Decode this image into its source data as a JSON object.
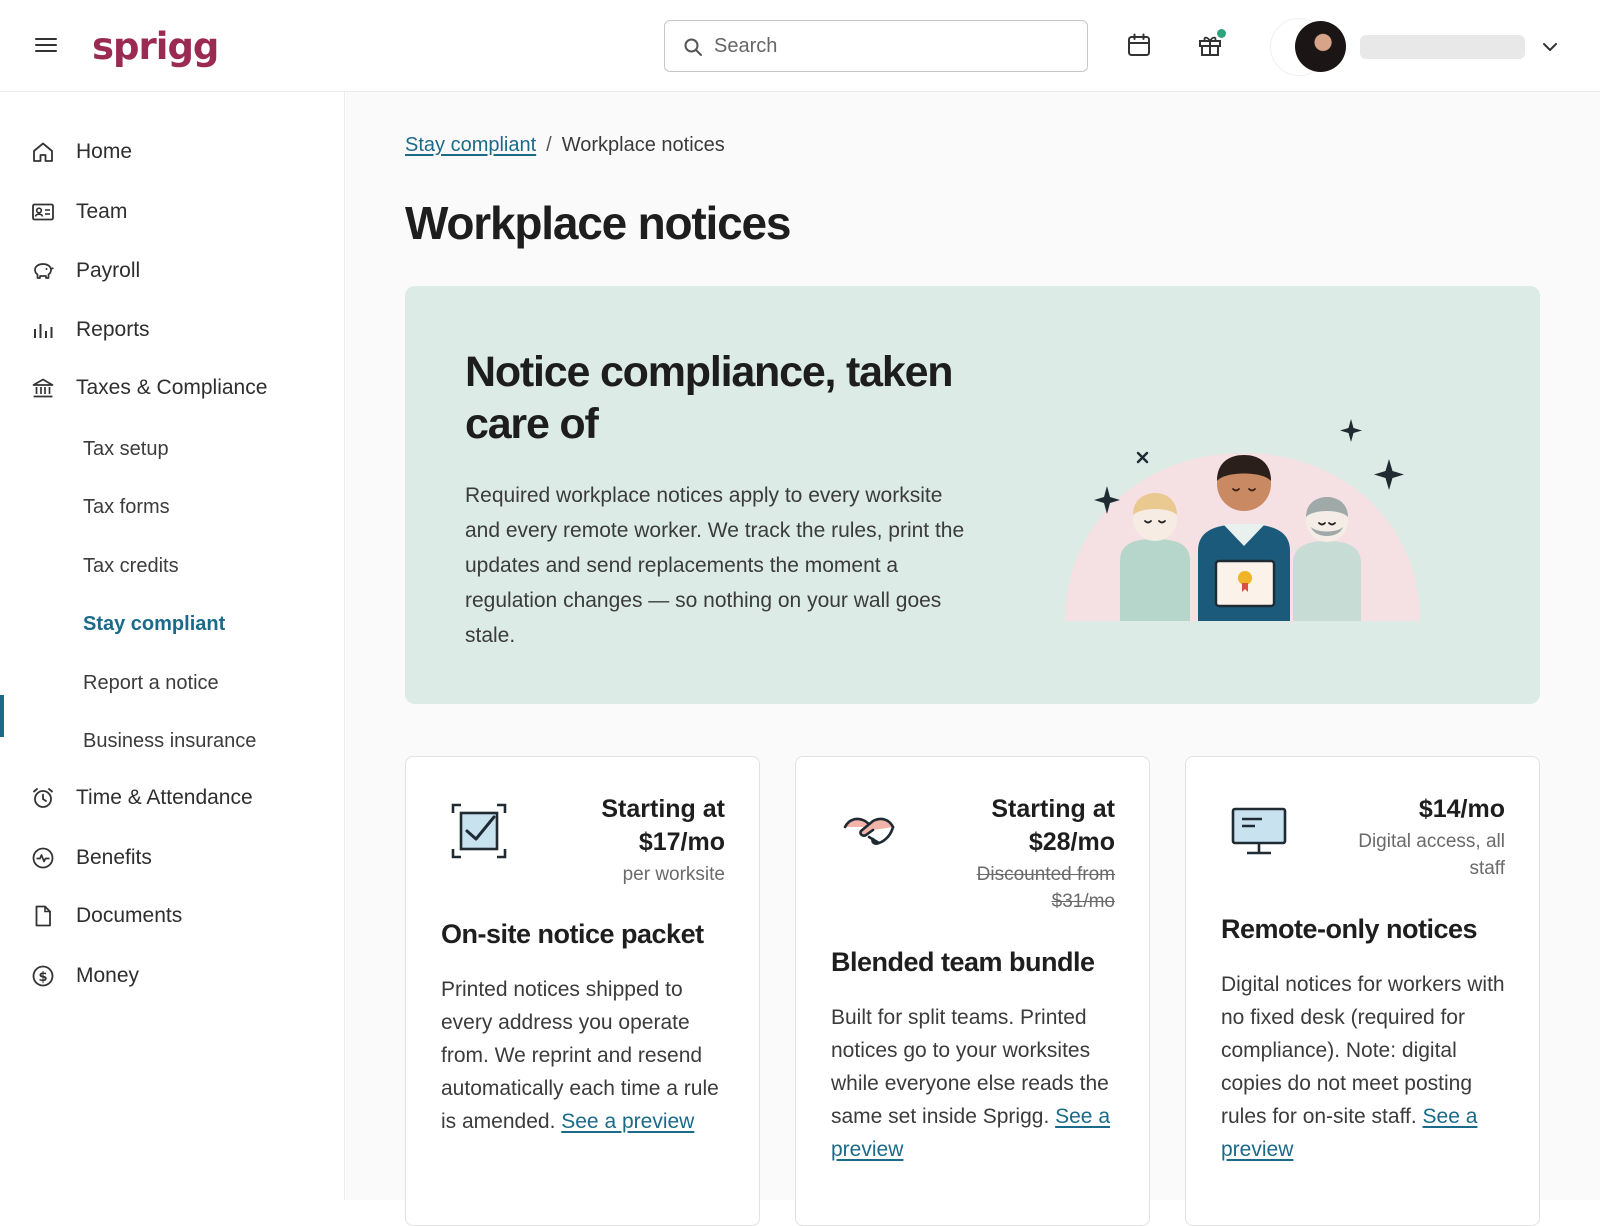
{
  "app": {
    "logo": "sprigg"
  },
  "header": {
    "search_placeholder": "Search",
    "icons": [
      "menu-icon",
      "calendar-icon",
      "gift-icon",
      "chevron-down-icon"
    ],
    "notification_dot_color": "#2fa47a"
  },
  "sidebar": {
    "items": [
      {
        "label": "Home",
        "icon": "home-icon"
      },
      {
        "label": "Team",
        "icon": "id-card-icon"
      },
      {
        "label": "Payroll",
        "icon": "piggy-bank-icon"
      },
      {
        "label": "Reports",
        "icon": "bar-chart-icon"
      },
      {
        "label": "Taxes & Compliance",
        "icon": "bank-icon"
      },
      {
        "label": "Time & Attendance",
        "icon": "alarm-clock-icon"
      },
      {
        "label": "Benefits",
        "icon": "heart-pulse-icon"
      },
      {
        "label": "Documents",
        "icon": "document-icon"
      },
      {
        "label": "Money",
        "icon": "dollar-circle-icon"
      }
    ],
    "sub_items": [
      "Tax setup",
      "Tax forms",
      "Tax credits",
      "Stay compliant",
      "Report a notice",
      "Business insurance"
    ],
    "active_sub_item": "Stay compliant",
    "accent_color": "#1b6a8a"
  },
  "breadcrumb": {
    "parent": "Stay compliant",
    "separator": "/",
    "current": "Workplace notices"
  },
  "page": {
    "title": "Workplace notices"
  },
  "hero": {
    "title": "Notice compliance, taken care of",
    "text": "Required workplace notices apply to every worksite and every remote worker. We track the rules, print the updates and send replacements the moment a regulation changes — so nothing on your wall goes stale.",
    "background": "#dcebe5"
  },
  "cards": [
    {
      "icon": "checkbox-frame-icon",
      "price_main": "Starting at $17/mo",
      "price_sub": "per worksite",
      "title": "On-site notice packet",
      "desc": "Printed notices shipped to every address you operate from. We reprint and resend automatically each time a rule is amended.",
      "link": "See a preview"
    },
    {
      "icon": "handshake-icon",
      "price_main": "Starting at $28/mo",
      "price_sub": "Discounted from $31/mo",
      "title": "Blended team bundle",
      "desc": "Built for split teams. Printed notices go to your worksites while everyone else reads the same set inside Sprigg.",
      "link": "See a preview"
    },
    {
      "icon": "monitor-icon",
      "price_main": "$14/mo",
      "price_sub": "Digital access, all staff",
      "title": "Remote-only notices",
      "desc": "Digital notices for workers with no fixed desk (required for compliance). Note: digital copies do not meet posting rules for on-site staff.",
      "link": "See a preview"
    }
  ]
}
